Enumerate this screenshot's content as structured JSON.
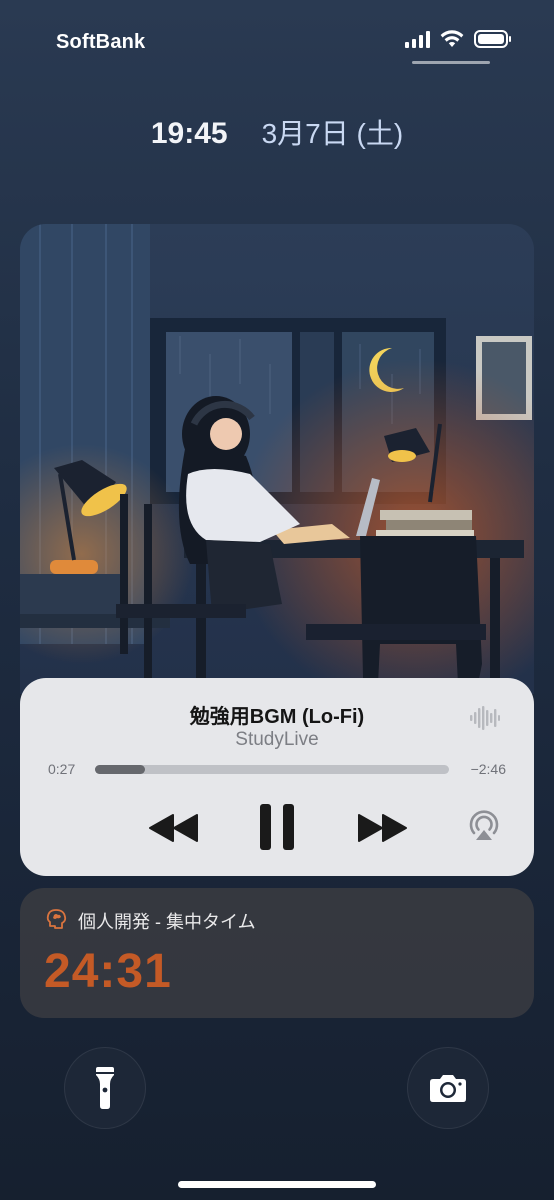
{
  "status_bar": {
    "carrier": "SoftBank",
    "signal_bars": 4,
    "wifi_icon": "wifi-icon",
    "battery_level": 1.0
  },
  "lock_screen": {
    "time": "19:45",
    "date": "3月7日 (土)"
  },
  "now_playing": {
    "artwork": "lofi-study-girl-illustration",
    "title": "勉強用BGM (Lo-Fi)",
    "artist": "StudyLive",
    "elapsed": "0:27",
    "remaining": "−2:46",
    "progress": 0.14,
    "controls": {
      "rewind_icon": "rewind-icon",
      "pause_icon": "pause-icon",
      "forward_icon": "fast-forward-icon",
      "airplay_icon": "airplay-icon",
      "wave_icon": "audio-wave-icon"
    }
  },
  "live_activity": {
    "icon": "brain-icon",
    "label": "個人開発 - 集中タイム",
    "timer": "24:31",
    "accent": "#c45a26"
  },
  "quick_actions": {
    "flashlight_icon": "flashlight-icon",
    "camera_icon": "camera-icon"
  },
  "colors": {
    "background": "#1f2d42",
    "player_card": "#e6e7ea",
    "focus_card": "#373a40"
  }
}
